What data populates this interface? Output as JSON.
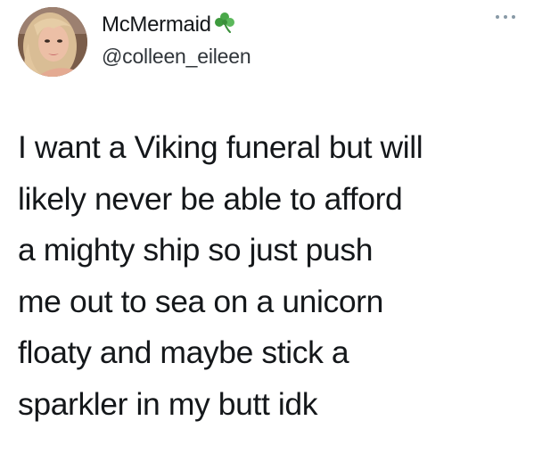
{
  "author": {
    "display_name": "McMermaid",
    "handle": "@colleen_eileen",
    "badge_icon": "shamrock-icon",
    "avatar_colors": {
      "hair": "#e3c9a3",
      "skin": "#e8b49a",
      "background": "#8a6a55"
    }
  },
  "menu": {
    "icon": "more-options-icon"
  },
  "tweet": {
    "lines": [
      "I want a Viking funeral but will",
      "likely never be able to afford",
      "a mighty ship so just push",
      "me out to sea on a unicorn",
      "floaty and maybe stick a",
      "sparkler in my butt idk"
    ]
  },
  "colors": {
    "text": "#14171a",
    "secondary_text": "#30353a",
    "muted_icon": "#8899a6",
    "shamrock_green": "#4aa84a"
  }
}
